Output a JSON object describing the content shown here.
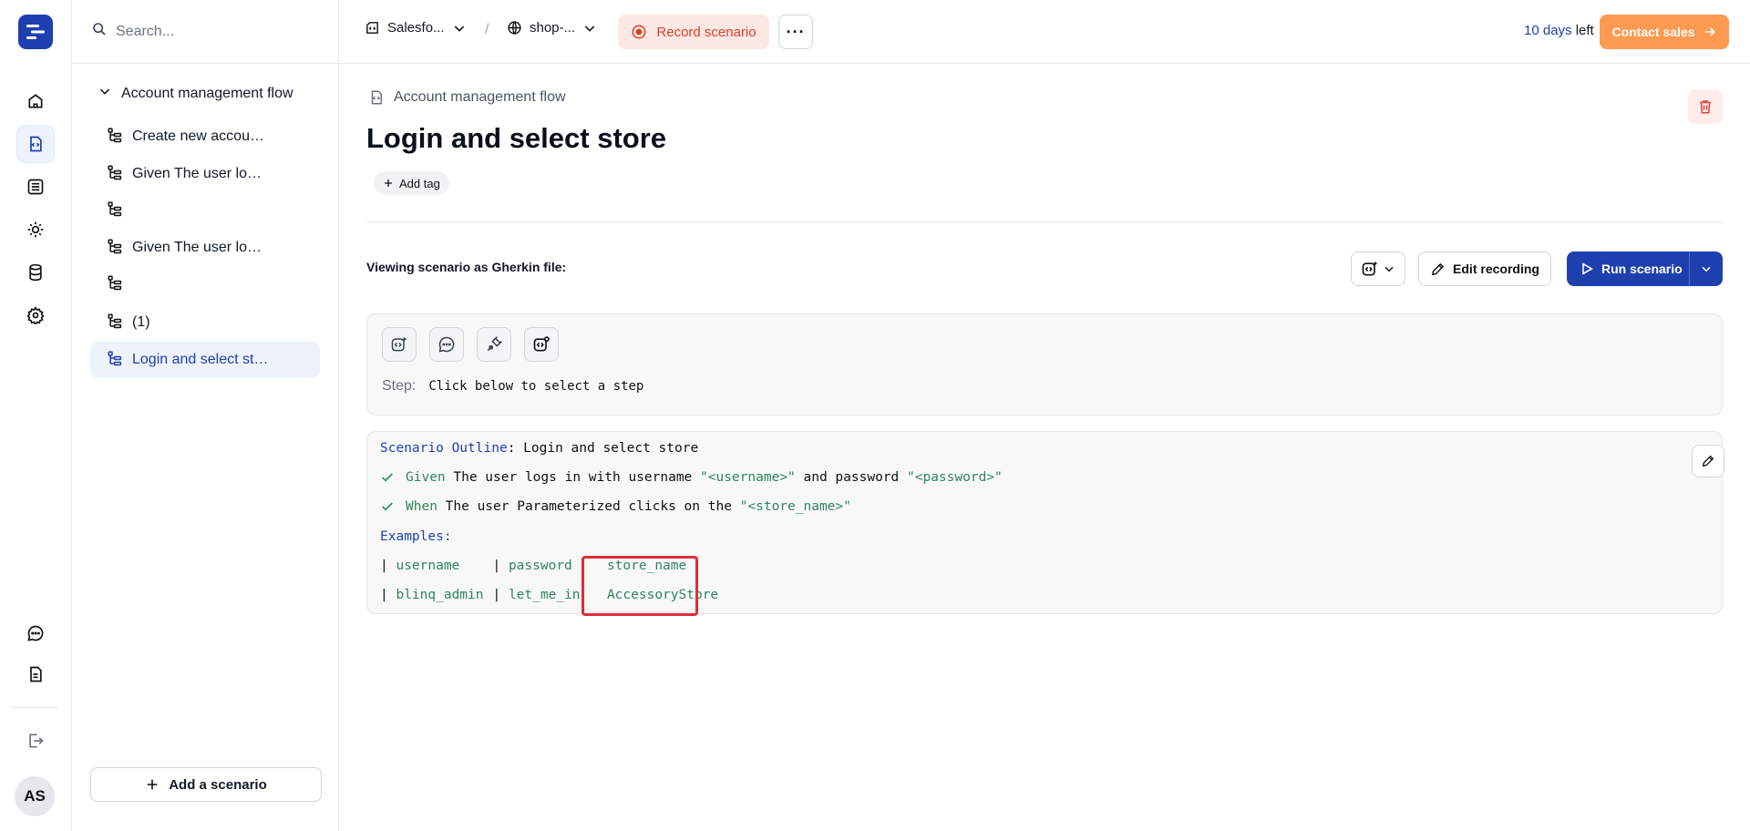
{
  "search": {
    "placeholder": "Search..."
  },
  "sidebar": {
    "root_label": "Account management flow",
    "items": [
      {
        "label": "Create new account and log in"
      },
      {
        "label": "Given The user logs in"
      },
      {
        "label": ""
      },
      {
        "label": "Given The user logs in"
      },
      {
        "label": ""
      },
      {
        "label": "(1)"
      },
      {
        "label": "Login and select store"
      }
    ],
    "add_scenario_label": "Add a scenario"
  },
  "rail": {
    "avatar_initials": "AS"
  },
  "topbar": {
    "project_label": "Salesfo...",
    "separator": "/",
    "env_label": "shop-...",
    "record_label": "Record scenario",
    "more_label": "···",
    "trial_days": "10 days",
    "trial_suffix": " left",
    "contact_label": "Contact sales"
  },
  "main": {
    "flow_crumb": "Account management flow",
    "title": "Login and select store",
    "add_tag_label": "Add tag",
    "viewing_label": "Viewing scenario as Gherkin file:",
    "edit_recording_label": "Edit recording",
    "run_scenario_label": "Run scenario",
    "step_label": "Step:",
    "step_value": "Click below to select a step"
  },
  "gherkin": {
    "outline_keyword": "Scenario Outline",
    "outline_colon": ": ",
    "outline_name": "Login and select store",
    "step1": {
      "keyword": "Given",
      "text_a": " The user logs in with username ",
      "param_a": "\"<username>\"",
      "text_b": " and password ",
      "param_b": "\"<password>\""
    },
    "step2": {
      "keyword": "When",
      "text_a": " The user Parameterized clicks on the ",
      "param_a": "\"<store_name>\""
    },
    "examples_keyword": "Examples",
    "examples_colon": ":",
    "table": {
      "header": [
        "username",
        "password",
        "store_name"
      ],
      "row": [
        "blinq_admin",
        "let_me_in",
        "AccessoryStore"
      ]
    }
  },
  "colors": {
    "brand": "#1e40af",
    "record": "#dc3f25",
    "contact": "#fb9a50",
    "param_green": "#2f855a",
    "highlight": "#dc2f3b"
  }
}
